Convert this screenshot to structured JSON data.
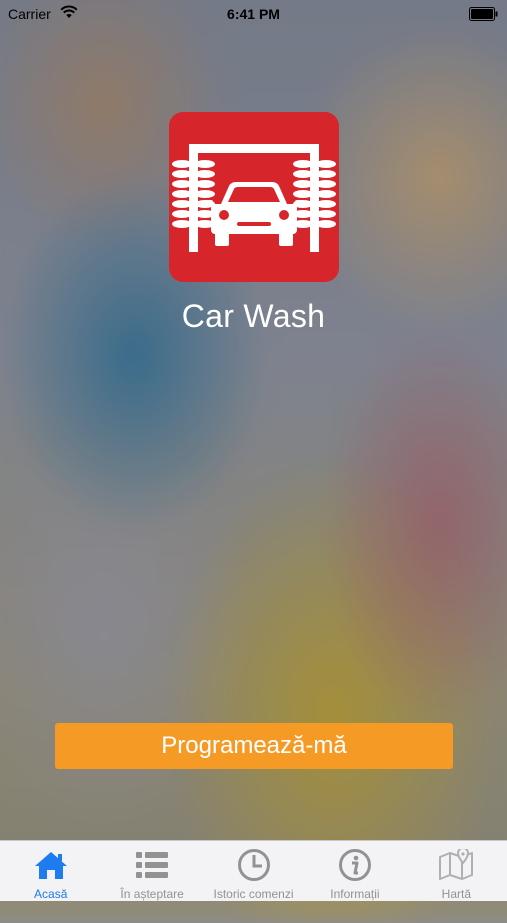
{
  "status_bar": {
    "carrier": "Carrier",
    "time": "6:41 PM"
  },
  "app": {
    "title": "Car Wash",
    "icon": "car-wash-icon",
    "icon_color": "#d6262c"
  },
  "action_button": {
    "label": "Programează-mă",
    "color": "#f59a25"
  },
  "tab_bar": {
    "active_color": "#1e7bf0",
    "inactive_color": "#929292",
    "tabs": [
      {
        "label": "Acasă",
        "icon": "home-icon",
        "active": true
      },
      {
        "label": "În așteptare",
        "icon": "list-icon",
        "active": false
      },
      {
        "label": "Istoric comenzi",
        "icon": "clock-icon",
        "active": false
      },
      {
        "label": "Informații",
        "icon": "info-icon",
        "active": false
      },
      {
        "label": "Hartă",
        "icon": "map-icon",
        "active": false
      }
    ]
  }
}
